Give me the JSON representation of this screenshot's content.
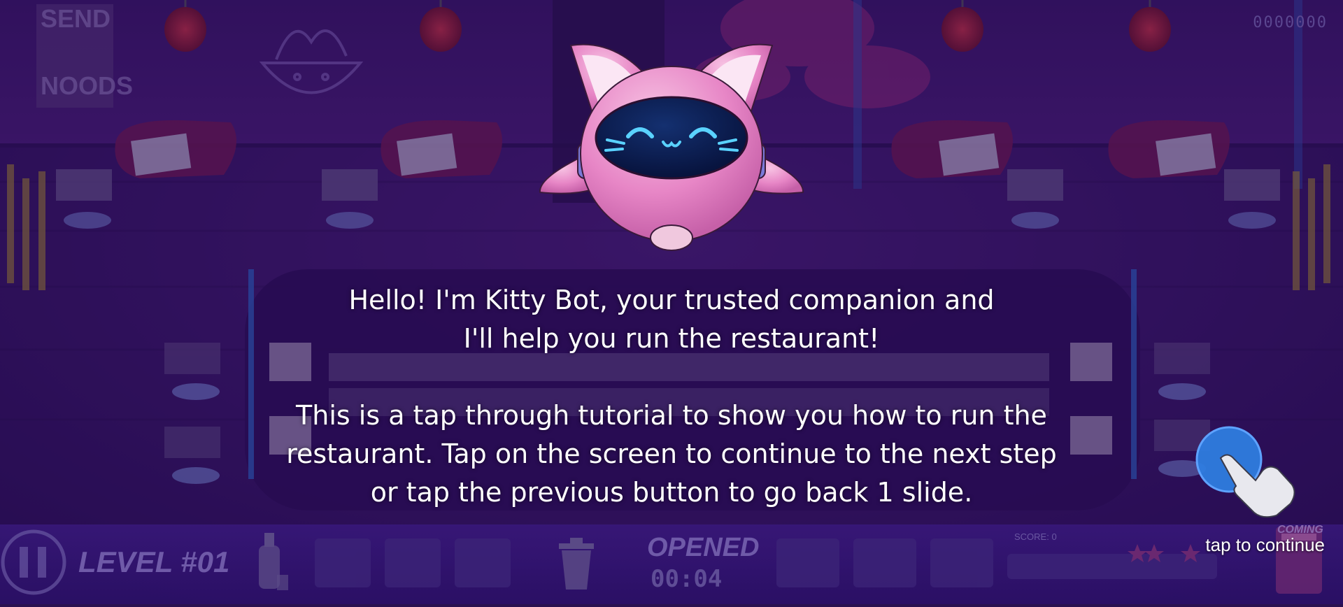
{
  "game": {
    "top_right_counter": "0000000",
    "poster_text_1": "SEND",
    "poster_text_2": "NOODS"
  },
  "tutorial": {
    "character": "Kitty Bot",
    "line1": "Hello! I'm Kitty Bot, your trusted companion and",
    "line2": "I'll help you run the restaurant!",
    "line3": "This is a tap through tutorial to show you how to run the",
    "line4": "restaurant. Tap on the screen to continue to the next step",
    "line5": "or tap the previous button to go back 1 slide.",
    "tap_hint": "tap to continue"
  },
  "hud": {
    "level_label": "LEVEL #01",
    "status": "OPENED",
    "timer": "00:04",
    "score_label": "SCORE: 0",
    "coming_label": "COMING",
    "star_rating": 0,
    "icons": [
      "pause-icon",
      "sake-bottle-icon",
      "trash-icon",
      "star-icon",
      "book-icon",
      "hand-pointer-icon"
    ]
  },
  "colors": {
    "background": "#2a1150",
    "hud": "#3a1a80",
    "kitty_pink": "#e889c8",
    "visor": "#0d1a4a",
    "accent_blue": "#2f7de0"
  }
}
